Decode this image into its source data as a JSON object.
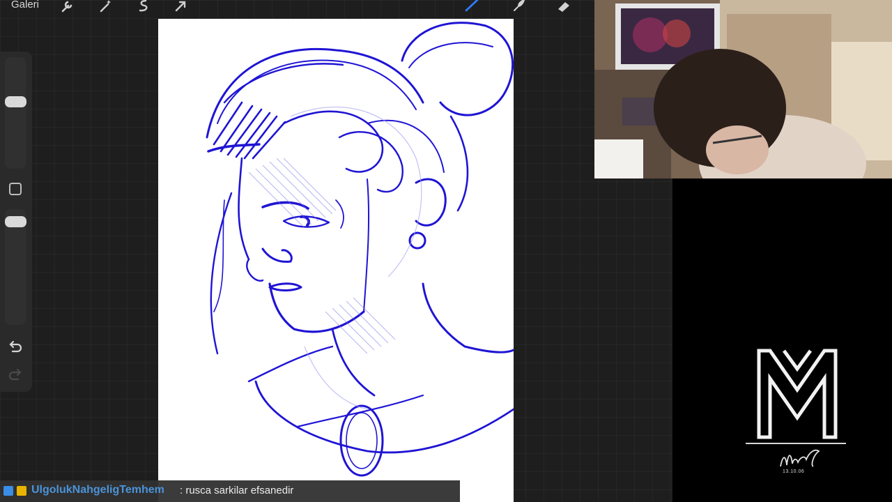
{
  "app": {
    "gallery_label": "Galeri",
    "accent_color": "#2d7cff",
    "sketch_color": "#1f14d4"
  },
  "toolbar": {
    "tools": [
      {
        "name": "wrench-icon"
      },
      {
        "name": "magic-wand-icon"
      },
      {
        "name": "selection-icon"
      },
      {
        "name": "transform-arrow-icon"
      },
      {
        "name": "brush-icon",
        "active": true
      },
      {
        "name": "smudge-icon"
      },
      {
        "name": "eraser-icon"
      }
    ]
  },
  "sidebar": {
    "brush_size_value": 0.82,
    "opacity_value": 0.78,
    "modify_icon": "square-icon",
    "undo_icon": "undo-icon",
    "redo_icon": "redo-icon"
  },
  "webcam": {
    "description_icon": "streamer-webcam"
  },
  "brand": {
    "logo_icon": "mm-logo-icon",
    "signature_date": "13.10.06"
  },
  "chat": {
    "badges": [
      "verified-badge-icon",
      "crown-badge-icon"
    ],
    "username": "UlgolukNahgeligTemhem",
    "message": ": rusca sarkilar efsanedir"
  }
}
